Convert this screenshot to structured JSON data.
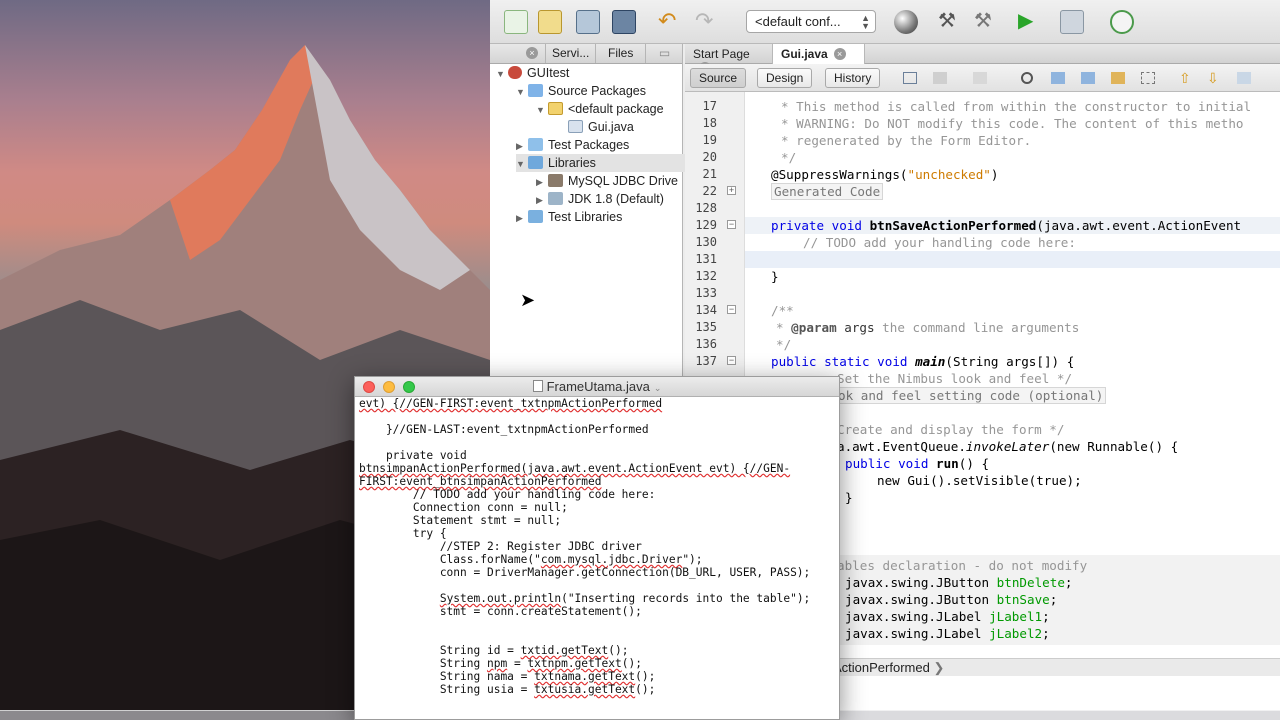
{
  "ide": {
    "config_select": "<default conf...",
    "left_tabs": [
      "Servi...",
      "Files"
    ],
    "tree": [
      {
        "label": "GUItest"
      },
      {
        "label": "Source Packages"
      },
      {
        "label": "<default package"
      },
      {
        "label": "Gui.java"
      },
      {
        "label": "Test Packages"
      },
      {
        "label": "Libraries"
      },
      {
        "label": "MySQL JDBC Drive"
      },
      {
        "label": "JDK 1.8 (Default)"
      },
      {
        "label": "Test Libraries"
      }
    ],
    "editor_tabs": [
      "Start Page",
      "Gui.java"
    ],
    "modes": [
      "Source",
      "Design",
      "History"
    ],
    "line_numbers": [
      "17",
      "18",
      "19",
      "20",
      "21",
      "22",
      "128",
      "129",
      "130",
      "131",
      "132",
      "133",
      "134",
      "135",
      "136",
      "137"
    ],
    "code": {
      "l17": "* This method is called from within the constructor to initial",
      "l18": "* WARNING: Do NOT modify this code. The content of this metho",
      "l19": "* regenerated by the Form Editor.",
      "l20": "*/",
      "l21a": "@SuppressWarnings(",
      "l21b": "\"unchecked\"",
      "l21c": ")",
      "l22": "Generated Code",
      "l129a": "private void ",
      "l129b": "btnSaveActionPerformed",
      "l129c": "(java.awt.event.ActionEvent",
      "l130": "// TODO add your handling code here:",
      "l132": "}",
      "l134": "/**",
      "l135a": "* ",
      "l135b": "@param",
      "l135c": " args",
      "l135d": " the command line arguments",
      "l136": "*/",
      "l137a": "public static void ",
      "l137b": "main",
      "l137c": "(String args[]) {",
      "r1a": "Set the Nimbus look and feel */",
      "r2": "ok and feel setting code (optional)",
      "r3": "Create and display the form */",
      "r4a": "a.awt.EventQueue.",
      "r4b": "invokeLater",
      "r4c": "(new Runnable() {",
      "r5a": "public void ",
      "r5b": "run",
      "r5c": "() {",
      "r6": "new Gui().setVisible(true);",
      "r7": "}",
      "r8": "ables declaration - do not modify",
      "r9a": "javax.swing.JButton ",
      "r9b": "btnDelete",
      "r10b": "btnSave",
      "r11a": "javax.swing.JLabel ",
      "r11b": "jLabel1",
      "r12b": "jLabel2",
      "semi": ";"
    },
    "breadcrumb": "ActionPerformed"
  },
  "textwin": {
    "title": "FrameUtama.java",
    "lines": {
      "t1": "evt) {//GEN-FIRST:event_txtnpmActionPerformed",
      "t2": "    }//GEN-LAST:event_txtnpmActionPerformed",
      "t3": "    private void",
      "t4": "btnsimpanActionPerformed(java.awt.event.ActionEvent evt) {//GEN-",
      "t5": "FIRST:event_btnsimpanActionPerformed",
      "t6": "        // TODO add your handling code here:",
      "t7": "        Connection conn = null;",
      "t8": "        Statement stmt = null;",
      "t9": "        try {",
      "t10": "            //STEP 2: Register JDBC driver",
      "t11a": "            Class.forName(\"",
      "t11b": "com.mysql.jdbc.Driver",
      "t11c": "\");",
      "t12": "            conn = DriverManager.getConnection(DB_URL, USER, PASS);",
      "t13a": "            ",
      "t13b": "System.out.println",
      "t13c": "(\"Inserting records into the table\");",
      "t14": "            stmt = conn.createStatement();",
      "t15a": "            String id = ",
      "t15b": "txtid.getText",
      "t16a": "            String ",
      "t16b": "npm",
      "t16c": " = ",
      "t16d": "txtnpm.getText",
      "t17a": "            String nama = ",
      "t17b": "txtnama.getText",
      "t18a": "            String usia = ",
      "t18b": "txtusia.getText",
      "tend": "();"
    }
  },
  "colors": {
    "keyword": "#0000e6",
    "string": "#ce7b00",
    "field": "#009900",
    "comment": "#969696"
  }
}
